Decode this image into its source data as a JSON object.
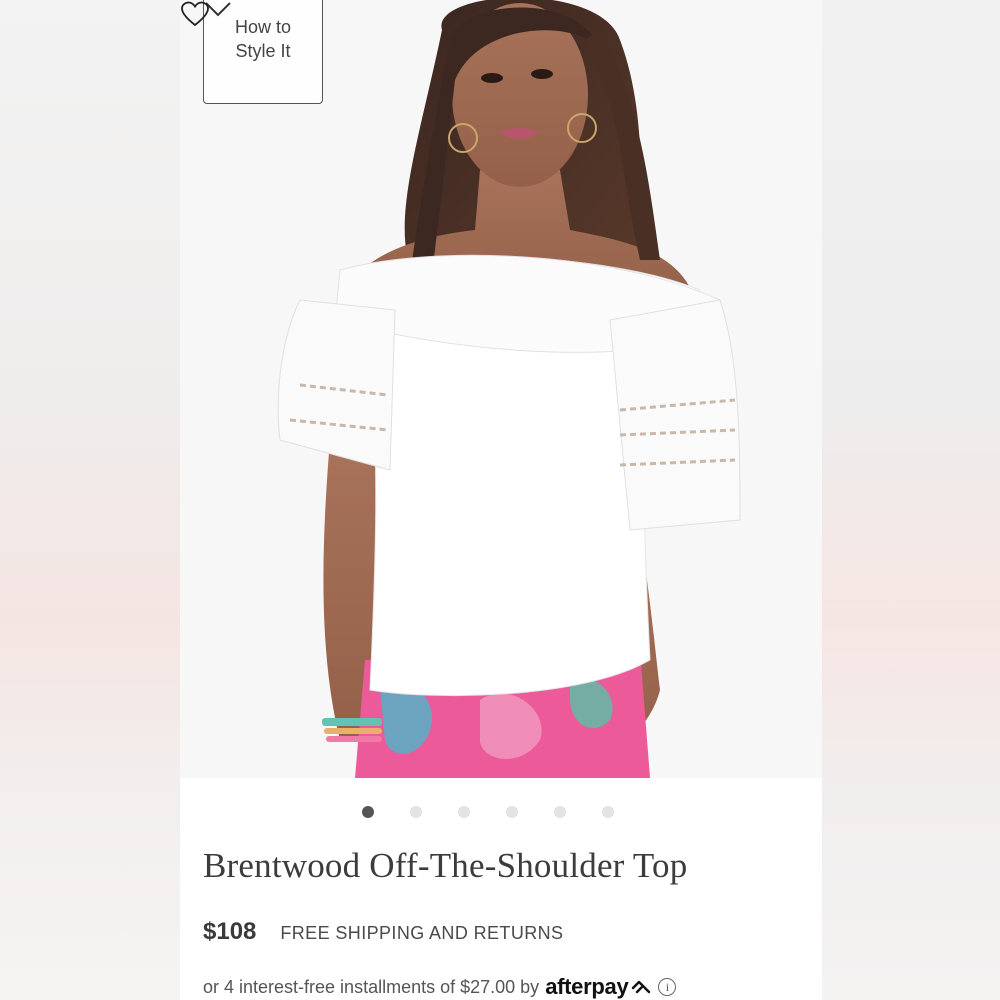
{
  "style_button": {
    "line1": "How to",
    "line2": "Style It"
  },
  "product": {
    "title": "Brentwood Off-The-Shoulder Top",
    "price": "$108",
    "shipping": "FREE SHIPPING AND RETURNS"
  },
  "carousel": {
    "total": 6,
    "active_index": 0
  },
  "afterpay": {
    "text": "or 4 interest-free installments of $27.00 by",
    "brand": "afterpay"
  },
  "colors": {
    "accent_text": "#3c3c3c",
    "dot_active": "#555555",
    "dot_inactive": "#e3e3e3"
  },
  "icons": {
    "favorite": "heart-outline-icon",
    "expand": "chevron-down-icon",
    "info": "info-circle-icon"
  }
}
